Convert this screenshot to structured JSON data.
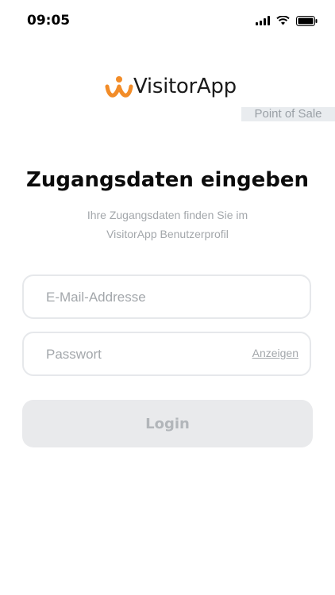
{
  "status_bar": {
    "time": "09:05"
  },
  "brand": {
    "name": "VisitorApp",
    "subtitle": "Point of Sale",
    "colors": {
      "logo": "#f28c28",
      "text": "#1b1b1b"
    }
  },
  "login": {
    "title": "Zugangsdaten eingeben",
    "subtitle_line1": "Ihre Zugangsdaten finden Sie im",
    "subtitle_line2": "VisitorApp Benutzerprofil",
    "email_placeholder": "E-Mail-Addresse",
    "password_placeholder": "Passwort",
    "show_password_label": "Anzeigen",
    "login_label": "Login"
  },
  "icons": {
    "signal": "cellular-signal-icon",
    "wifi": "wifi-icon",
    "battery": "battery-icon",
    "logo": "visitorapp-logo-icon"
  }
}
